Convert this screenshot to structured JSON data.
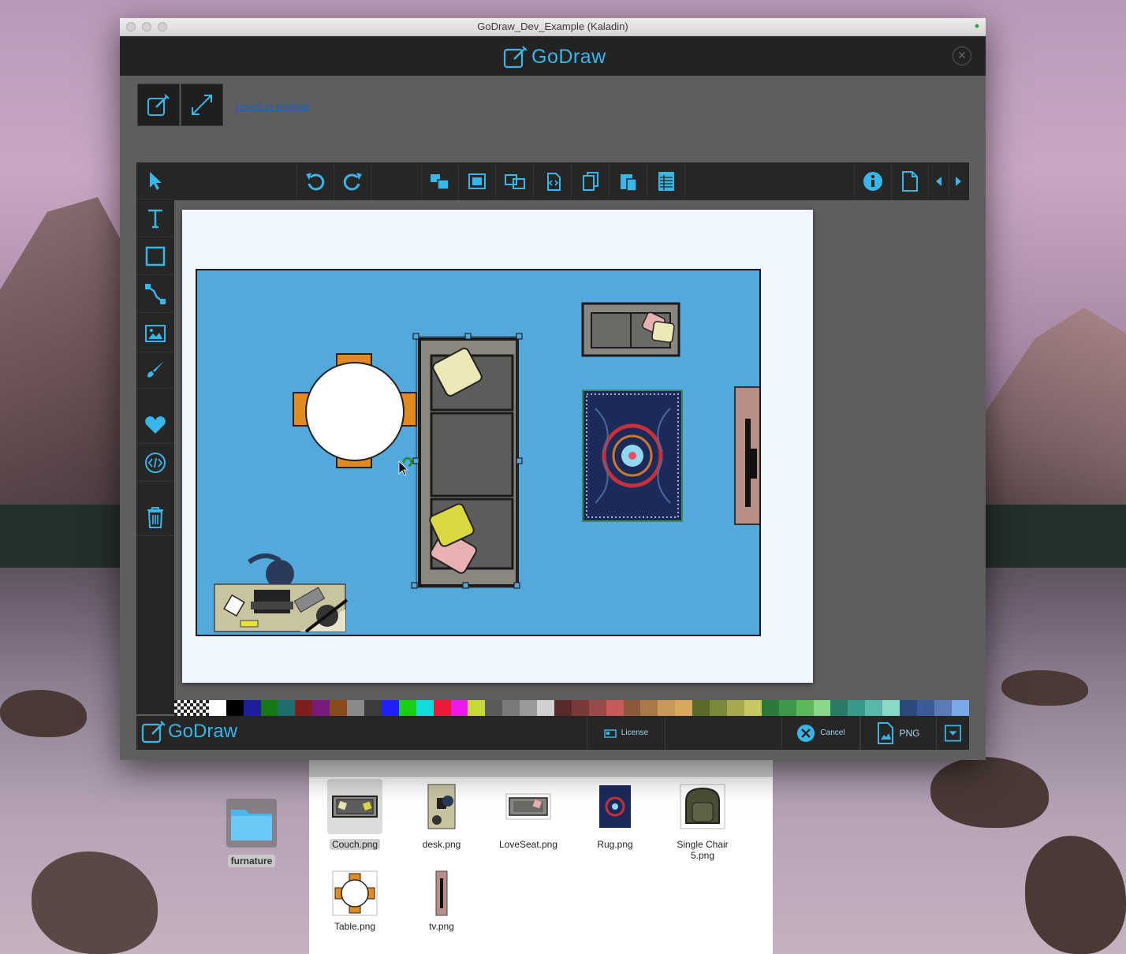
{
  "window": {
    "title": "GoDraw_Dev_Example (Kaladin)"
  },
  "header": {
    "brand": "GoDraw",
    "close_icon": "close-circle-icon"
  },
  "actions": {
    "revert_label": "revert to original"
  },
  "left_tools": [
    "pointer-icon",
    "text-icon",
    "rectangle-icon",
    "connector-icon",
    "image-icon",
    "brush-icon",
    "heart-icon",
    "code-icon",
    "trash-icon"
  ],
  "top_toolbar": {
    "history": [
      "undo-icon",
      "redo-icon"
    ],
    "arrange": [
      "bring-forward-icon",
      "group-icon",
      "ungroup-icon",
      "paste-code-icon",
      "copy-icon",
      "paste-icon",
      "grid-icon"
    ],
    "right": [
      "info-icon",
      "page-icon",
      "prev-icon",
      "next-icon"
    ]
  },
  "palette": [
    "#ffffff",
    "#000000",
    "#1f1f9e",
    "#157a15",
    "#1e6e6e",
    "#7e1e1e",
    "#7a1a7a",
    "#8a4a1a",
    "#8a8a8a",
    "#3c3c3c",
    "#2020ff",
    "#18d018",
    "#10dcdc",
    "#ee1a3a",
    "#ee18ee",
    "#c8d838",
    "#5a5a5a",
    "#7a7a7a",
    "#9a9a9a",
    "#d0d0d0",
    "#5a2a2a",
    "#7a3a3a",
    "#9a4a4a",
    "#c85a5a",
    "#8a5a3a",
    "#a87a4a",
    "#c89a5a",
    "#d8a860",
    "#5a6a2a",
    "#7a8a3a",
    "#a8a850",
    "#c8c860",
    "#2a7a3a",
    "#3a9a4a",
    "#5ab85a",
    "#8ad88a",
    "#2a7a6a",
    "#3a9a8a",
    "#5ab8a8",
    "#8ad8c8",
    "#2a4a7a",
    "#3a5a9a",
    "#5a7ab8",
    "#7aa8e8"
  ],
  "bottom": {
    "brand": "GoDraw",
    "license": "License",
    "cancel": "Cancel",
    "format": "PNG"
  },
  "finder": {
    "items": [
      {
        "name": "Couch.png"
      },
      {
        "name": "desk.png"
      },
      {
        "name": "LoveSeat.png"
      },
      {
        "name": "Rug.png"
      },
      {
        "name": "Single Chair 5.png"
      },
      {
        "name": "Table.png"
      },
      {
        "name": "tv.png"
      }
    ]
  },
  "desktop": {
    "folder_label": "furnature"
  }
}
